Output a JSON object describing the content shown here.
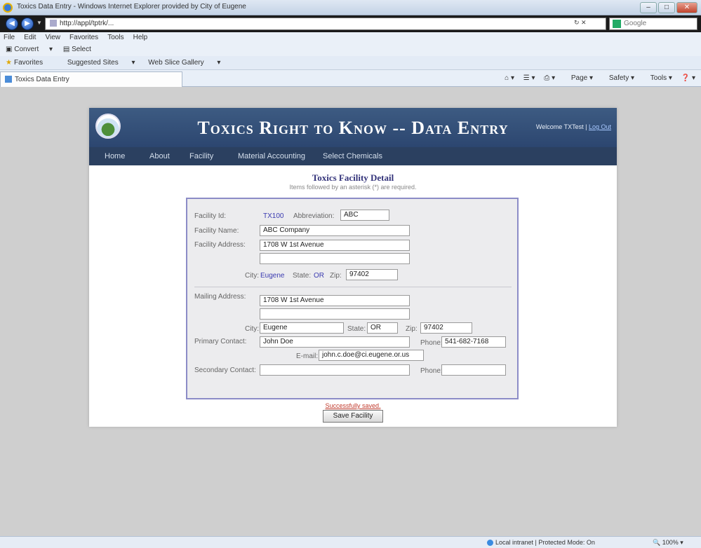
{
  "browser": {
    "window_title": "Toxics Data Entry - Windows Internet Explorer provided by City of Eugene",
    "url": "http://appl/tptrk/...",
    "search_placeholder": "Google",
    "menu": [
      "File",
      "Edit",
      "View",
      "Favorites",
      "Tools",
      "Help"
    ],
    "convert_label": "Convert",
    "select_label": "Select",
    "favorites_label": "Favorites",
    "favorites_items": [
      "Suggested Sites",
      "Web Slice Gallery"
    ],
    "tab_title": "Toxics Data Entry",
    "command_bar": [
      "Page",
      "Safety",
      "Tools"
    ],
    "status_zone": "Local intranet | Protected Mode: On",
    "zoom": "100%"
  },
  "site": {
    "title": "Toxics Right to Know -- Data Entry",
    "welcome_text": "Welcome TXTest",
    "logout_label": "Log Out",
    "nav": [
      "Home",
      "About",
      "Facility",
      "Material Accounting",
      "Select Chemicals"
    ]
  },
  "detail": {
    "title": "Toxics Facility Detail",
    "subtitle": "Items followed by an asterisk (*) are required.",
    "facility_id_label": "Facility Id:",
    "facility_id": "TX100",
    "abbreviation_label": "Abbreviation:",
    "abbreviation": "ABC",
    "facility_name_label": "Facility Name:",
    "facility_name": "ABC Company",
    "facility_address_label": "Facility Address:",
    "facility_address1": "1708 W 1st Avenue",
    "facility_address2": "",
    "city_label": "City:",
    "city": "Eugene",
    "state_label": "State:",
    "state": "OR",
    "zip_label": "Zip:",
    "zip": "97402",
    "mailing_address_label": "Mailing Address:",
    "mailing_address1": "1708 W 1st Avenue",
    "mailing_address2": "",
    "mailing_city_label": "City:",
    "mailing_city": "Eugene",
    "mailing_state_label": "State:",
    "mailing_state": "OR",
    "mailing_zip_label": "Zip:",
    "mailing_zip": "97402",
    "primary_contact_label": "Primary Contact:",
    "primary_contact": "John Doe",
    "primary_phone_label": "Phone:",
    "primary_phone": "541-682-7168",
    "email_label": "E-mail:",
    "email": "john.c.doe@ci.eugene.or.us",
    "secondary_contact_label": "Secondary Contact:",
    "secondary_contact": "",
    "secondary_phone_label": "Phone:",
    "secondary_phone": ""
  },
  "saved_message": "Successfully saved.",
  "save_button": "Save Facility"
}
